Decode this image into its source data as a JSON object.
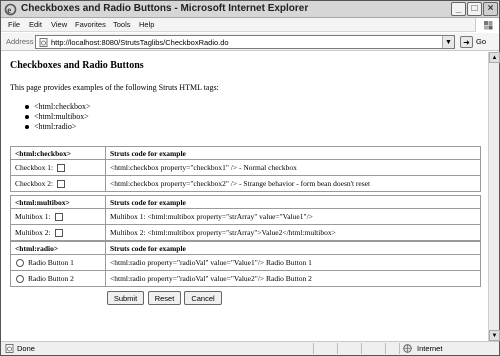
{
  "window": {
    "title": "Checkboxes and Radio Buttons - Microsoft Internet Explorer",
    "controls": {
      "minimize": "_",
      "maximize": "□",
      "close": "×"
    }
  },
  "menu": {
    "items": [
      "File",
      "Edit",
      "View",
      "Favorites",
      "Tools",
      "Help"
    ]
  },
  "address": {
    "label": "Address",
    "url": "http://localhost:8080/StrutsTaglibs/CheckboxRadio.do",
    "go_label": "Go"
  },
  "page": {
    "heading": "Checkboxes and Radio Buttons",
    "intro": "This page provides examples of the following Struts HTML tags:",
    "tags": [
      "<html:checkbox>",
      "<html:multibox>",
      "<html:radio>"
    ]
  },
  "tables": {
    "checkbox": {
      "head_tag": "<html:checkbox>",
      "head_code": "Struts code for example",
      "rows": [
        {
          "label": "Checkbox 1:",
          "code": "<html:checkbox property=\"checkbox1\" /> - Normal checkbox"
        },
        {
          "label": "Checkbox 2:",
          "code": "<html:checkbox property=\"checkbox2\" /> - Strange behavior - form bean doesn't reset"
        }
      ]
    },
    "multibox": {
      "head_tag": "<html:multibox>",
      "head_code": "Struts code for example",
      "rows": [
        {
          "label": "Multibox 1:",
          "code": "Multibox 1: <html:multibox property=\"strArray\" value=\"Value1\"/>"
        },
        {
          "label": "Multibox 2:",
          "code": "Multibox 2: <html:multibox property=\"strArray\">Value2</html:multibox>"
        }
      ]
    },
    "radio": {
      "head_tag": "<html:radio>",
      "head_code": "Struts code for example",
      "rows": [
        {
          "label": "Radio Button 1",
          "code": "<html:radio property=\"radioVal\" value=\"Value1\"/> Radio Button 1"
        },
        {
          "label": "Radio Button 2",
          "code": "<html:radio property=\"radioVal\" value=\"Value2\"/> Radio Button 2"
        }
      ]
    }
  },
  "buttons": {
    "submit": "Submit",
    "reset": "Reset",
    "cancel": "Cancel"
  },
  "status": {
    "text": "Done",
    "zone": "Internet"
  },
  "colors": {
    "title_bar": "#d6d6d6",
    "chrome": "#f4f4f4",
    "border": "#9a9a9a"
  },
  "icons": {
    "app": "ie-logo-icon",
    "page": "page-icon",
    "go": "go-arrow-icon",
    "status": "page-done-icon",
    "zone": "globe-icon"
  }
}
